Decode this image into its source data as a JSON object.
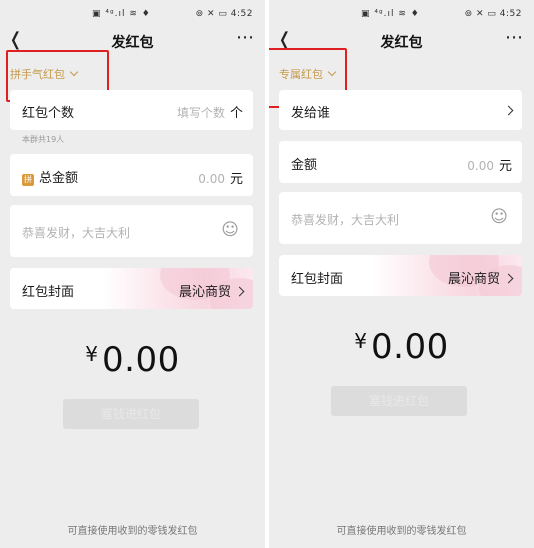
{
  "status": {
    "left": "▣ ⁴ᵍ.ıl ≋ ♦",
    "right": "⊚ ✕ ▭ 4:52"
  },
  "left": {
    "title": "发红包",
    "type_label": "拼手气红包",
    "count_label": "红包个数",
    "count_placeholder": "填写个数",
    "count_unit": "个",
    "group_hint": "本群共19人",
    "total_label": "总金额",
    "total_value": "0.00",
    "total_unit": "元",
    "blessing_placeholder": "恭喜发财，大吉大利",
    "cover_label": "红包封面",
    "cover_value": "晨沁商贸",
    "amount_currency": "¥",
    "amount_value": "0.00",
    "send_label": "塞钱进红包",
    "footer": "可直接使用收到的零钱发红包"
  },
  "right": {
    "title": "发红包",
    "type_label": "专属红包",
    "recipient_label": "发给谁",
    "amount_label": "金额",
    "amount_field_value": "0.00",
    "amount_unit": "元",
    "blessing_placeholder": "恭喜发财，大吉大利",
    "cover_label": "红包封面",
    "cover_value": "晨沁商贸",
    "amount_currency": "¥",
    "amount_value": "0.00",
    "send_label": "塞钱进红包",
    "footer": "可直接使用收到的零钱发红包"
  },
  "icons": {
    "back": "back-chevron-icon",
    "more": "more-dots-icon",
    "dropdown": "chevron-down-icon",
    "arrow": "chevron-right-icon",
    "emoji": "emoji-add-icon",
    "money": "money-icon"
  },
  "colors": {
    "accent_gold": "#c69a4b",
    "highlight_red": "#e02020",
    "background": "#ededed",
    "card": "#ffffff",
    "button_disabled": "#dcdcdc"
  }
}
